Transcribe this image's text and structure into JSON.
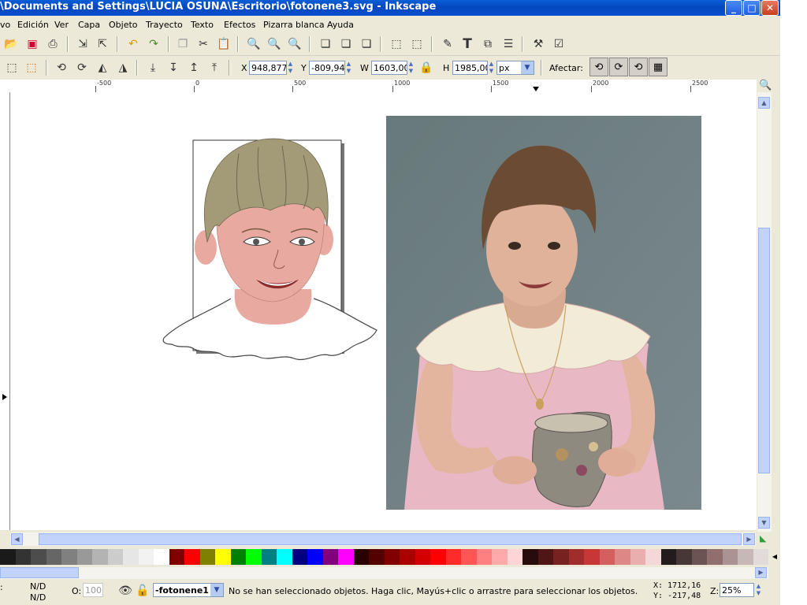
{
  "window": {
    "title": "\\Documents and Settings\\LUCIA OSUNA\\Escritorio\\fotonene3.svg - Inkscape",
    "minimize": "_",
    "maximize": "□",
    "close": "✕"
  },
  "menu": [
    "vo",
    "Edición",
    "Ver",
    "Capa",
    "Objeto",
    "Trayecto",
    "Texto",
    "Efectos",
    "Pizarra blanca",
    "Ayuda"
  ],
  "toolbar2": {
    "x_label": "X",
    "x_value": "948,877",
    "y_label": "Y",
    "y_value": "-809,94",
    "w_label": "W",
    "w_value": "1603,00",
    "h_label": "H",
    "h_value": "1985,00",
    "unit": "px",
    "affect_label": "Afectar:"
  },
  "ruler": {
    "h_ticks": [
      "-500",
      "0",
      "500",
      "1000",
      "1500",
      "2000",
      "2500"
    ]
  },
  "palette": {
    "colors": [
      "#1a1a1a",
      "#333333",
      "#4d4d4d",
      "#666666",
      "#808080",
      "#999999",
      "#b3b3b3",
      "#cccccc",
      "#e6e6e6",
      "#f2f2f2",
      "#ffffff",
      "#800000",
      "#ff0000",
      "#808000",
      "#ffff00",
      "#008000",
      "#00ff00",
      "#008080",
      "#00ffff",
      "#000080",
      "#0000ff",
      "#800080",
      "#ff00ff",
      "#2b0000",
      "#550000",
      "#800000",
      "#aa0000",
      "#d40000",
      "#ff0000",
      "#ff2a2a",
      "#ff5555",
      "#ff8080",
      "#ffaaaa",
      "#ffd5d5",
      "#280b0b",
      "#501616",
      "#782121",
      "#a02c2c",
      "#c83737",
      "#d35f5f",
      "#de8787",
      "#e9afaf",
      "#f4d7d7",
      "#241c1c",
      "#483737",
      "#6c5353",
      "#916f6f",
      "#ac9393",
      "#c8b7b7",
      "#e3dbdb"
    ]
  },
  "status": {
    "fill_label": "",
    "fill_value": "N/D",
    "stroke_value": "N/D",
    "opacity_label": "O:",
    "opacity_value": "100",
    "layer": "-fotonene1",
    "message": "No se han seleccionado objetos. Haga clic, Mayús+clic o arrastre para seleccionar los objetos.",
    "cursor_x": "X: 1712,16",
    "cursor_y": "Y: -217,48",
    "zoom_label": "Z:",
    "zoom_value": "25%"
  }
}
